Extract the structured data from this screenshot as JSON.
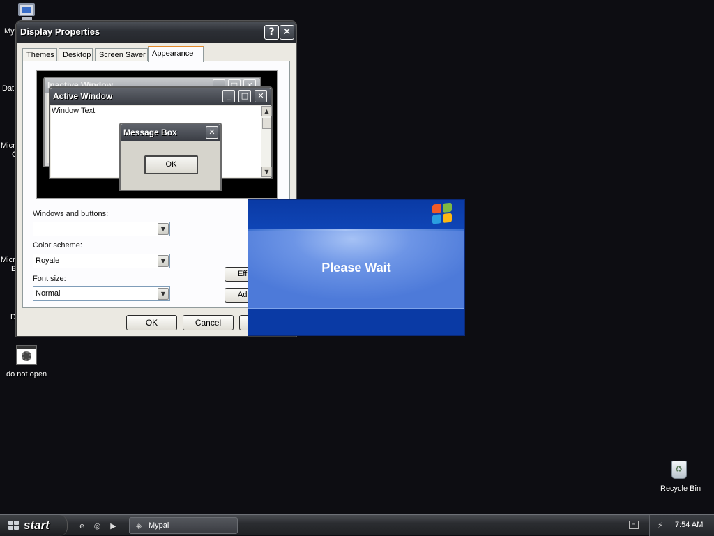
{
  "desktop": {
    "partial_labels": [
      "My",
      "Dat",
      "Micr",
      "C",
      "Micr",
      "B",
      "D"
    ],
    "icons": {
      "app": "do not open",
      "recycle": "Recycle Bin"
    }
  },
  "display_properties": {
    "title": "Display Properties",
    "help_glyph": "?",
    "close_glyph": "✕",
    "tabs": [
      "Themes",
      "Desktop",
      "Screen Saver",
      "Appearance"
    ],
    "active_tab": "Appearance",
    "preview": {
      "inactive_title": "Inactive Window",
      "active_title": "Active Window",
      "window_text": "Window Text",
      "message_title": "Message Box",
      "ok_label": "OK"
    },
    "fields": {
      "windows_buttons_label": "Windows and buttons:",
      "windows_buttons_value": "",
      "color_scheme_label": "Color scheme:",
      "color_scheme_value": "Royale",
      "font_size_label": "Font size:",
      "font_size_value": "Normal"
    },
    "side_buttons": {
      "effects_partial": "Eff",
      "advanced_partial": "Adv"
    },
    "buttons": {
      "ok": "OK",
      "cancel": "Cancel"
    }
  },
  "splash": {
    "message": "Please Wait",
    "colors": {
      "band": "#0a3a9e",
      "center": "#6d95e6"
    }
  },
  "taskbar": {
    "start_label": "start",
    "task_label": "Mypal",
    "clock": "7:54 AM"
  }
}
